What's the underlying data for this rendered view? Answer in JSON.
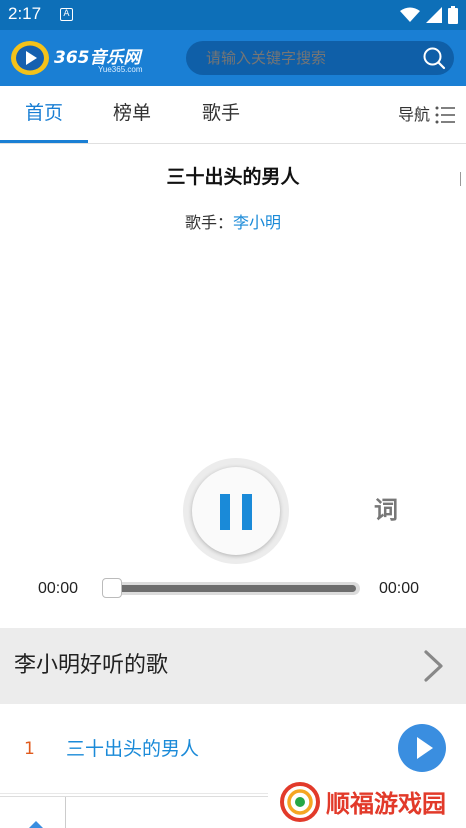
{
  "status_bar": {
    "time": "2:17",
    "notification_glyph": "A",
    "icons": [
      "wifi-icon",
      "signal-icon",
      "battery-icon"
    ]
  },
  "header": {
    "logo_text": "365音乐网",
    "logo_subtext": "Yue365.com",
    "search_placeholder": "请输入关键字搜索"
  },
  "tabs": [
    {
      "label": "首页",
      "active": true
    },
    {
      "label": "榜单",
      "active": false
    },
    {
      "label": "歌手",
      "active": false
    }
  ],
  "nav_label": "导航",
  "player": {
    "song_title": "三十出头的男人",
    "artist_prefix": "歌手：",
    "artist_name": "李小明",
    "lyrics_label": "词",
    "time_current": "00:00",
    "time_total": "00:00",
    "progress": 0
  },
  "section": {
    "title": "李小明好听的歌"
  },
  "song_list": [
    {
      "index": "1",
      "title": "三十出头的男人"
    }
  ],
  "watermark": {
    "text": "顺福游戏园"
  },
  "colors": {
    "header_blue": "#1a7fd4",
    "status_blue": "#0d6fb8",
    "accent_blue": "#1a8ad8",
    "index_orange": "#e05a1c",
    "watermark_red": "#e23a2a"
  }
}
